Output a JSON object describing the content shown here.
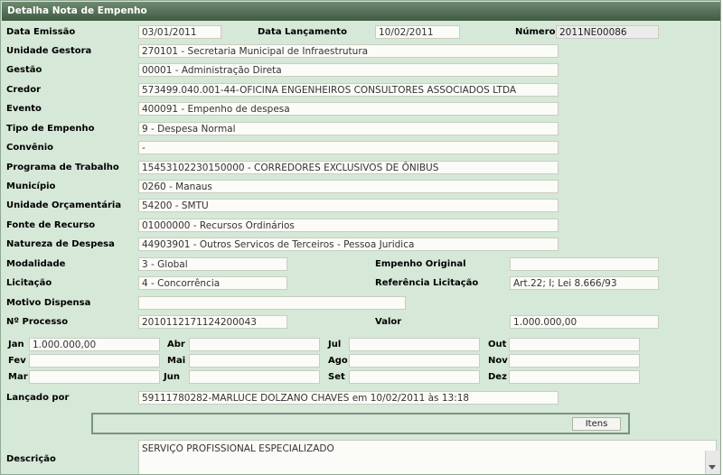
{
  "title": "Detalha Nota de Empenho",
  "header": {
    "data_emissao_label": "Data Emissão",
    "data_emissao": "03/01/2011",
    "data_lancamento_label": "Data Lançamento",
    "data_lancamento": "10/02/2011",
    "numero_label": "Número",
    "numero": "2011NE00086"
  },
  "fields": {
    "unidade_gestora_label": "Unidade Gestora",
    "unidade_gestora": "270101 - Secretaria Municipal de Infraestrutura",
    "gestao_label": "Gestão",
    "gestao": "00001 - Administração Direta",
    "credor_label": "Credor",
    "credor": "573499.040.001-44-OFICINA ENGENHEIROS CONSULTORES ASSOCIADOS LTDA",
    "evento_label": "Evento",
    "evento": "400091 - Empenho de despesa",
    "tipo_empenho_label": "Tipo de Empenho",
    "tipo_empenho": "9 - Despesa Normal",
    "convenio_label": "Convênio",
    "convenio": "-",
    "programa_label": "Programa de Trabalho",
    "programa": "15453102230150000 - CORREDORES EXCLUSIVOS DE ÔNIBUS",
    "municipio_label": "Município",
    "municipio": "0260 - Manaus",
    "unidade_orcamentaria_label": "Unidade Orçamentária",
    "unidade_orcamentaria": "54200 - SMTU",
    "fonte_label": "Fonte de Recurso",
    "fonte": "01000000 - Recursos Ordinários",
    "natureza_label": "Natureza de Despesa",
    "natureza": "44903901 - Outros Servicos de Terceiros - Pessoa Juridica",
    "modalidade_label": "Modalidade",
    "modalidade": "3 - Global",
    "empenho_original_label": "Empenho Original",
    "empenho_original": "",
    "licitacao_label": "Licitação",
    "licitacao": "4 - Concorrência",
    "referencia_label": "Referência Licitação",
    "referencia": "Art.22; I;  Lei 8.666/93",
    "motivo_label": "Motivo Dispensa",
    "motivo": "",
    "processo_label": "Nº Processo",
    "processo": "2010112171124200043",
    "valor_label": "Valor",
    "valor": "1.000.000,00"
  },
  "months": {
    "jan_label": "Jan",
    "jan": "1.000.000,00",
    "abr_label": "Abr",
    "abr": "",
    "jul_label": "Jul",
    "jul": "",
    "out_label": "Out",
    "out": "",
    "fev_label": "Fev",
    "fev": "",
    "mai_label": "Mai",
    "mai": "",
    "ago_label": "Ago",
    "ago": "",
    "nov_label": "Nov",
    "nov": "",
    "mar_label": "Mar",
    "mar": "",
    "jun_label": "Jun",
    "jun": "",
    "set_label": "Set",
    "set": "",
    "dez_label": "Dez",
    "dez": ""
  },
  "lancado_label": "Lançado por",
  "lancado": "59111780282-MARLUCE DOLZANO CHAVES em 10/02/2011 às 13:18",
  "itens_button": "Itens",
  "descricao_label": "Descrição",
  "descricao": "SERVIÇO PROFISSIONAL ESPECIALIZADO"
}
